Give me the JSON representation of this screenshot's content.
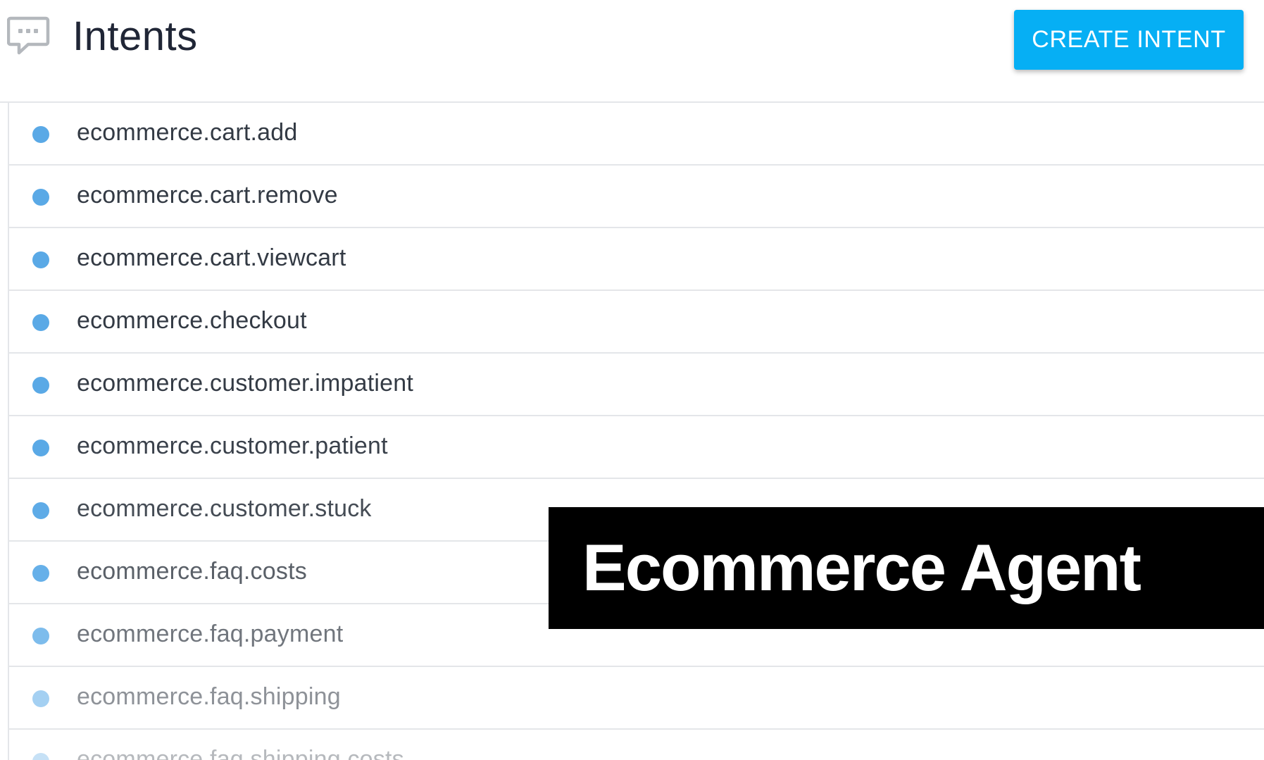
{
  "header": {
    "icon": "chat-bubble-icon",
    "title": "Intents",
    "create_button_label": "CREATE INTENT",
    "accent_color": "#06aff4"
  },
  "intents": [
    {
      "name": "ecommerce.cart.add",
      "dot_color": "#5aa9e6",
      "text_color": "#333a44"
    },
    {
      "name": "ecommerce.cart.remove",
      "dot_color": "#5aa9e6",
      "text_color": "#333a44"
    },
    {
      "name": "ecommerce.cart.viewcart",
      "dot_color": "#5aa9e6",
      "text_color": "#333a44"
    },
    {
      "name": "ecommerce.checkout",
      "dot_color": "#5aa9e6",
      "text_color": "#333a44"
    },
    {
      "name": "ecommerce.customer.impatient",
      "dot_color": "#5aa9e6",
      "text_color": "#343b45"
    },
    {
      "name": "ecommerce.customer.patient",
      "dot_color": "#5aa9e6",
      "text_color": "#3a414b"
    },
    {
      "name": "ecommerce.customer.stuck",
      "dot_color": "#5eabe7",
      "text_color": "#454c55"
    },
    {
      "name": "ecommerce.faq.costs",
      "dot_color": "#66b0e9",
      "text_color": "#5a6068"
    },
    {
      "name": "ecommerce.faq.payment",
      "dot_color": "#7dbcec",
      "text_color": "#71767d"
    },
    {
      "name": "ecommerce.faq.shipping",
      "dot_color": "#a4d0f2",
      "text_color": "#8e9298"
    },
    {
      "name": "ecommerce.faq.shipping.costs",
      "dot_color": "#c6e1f6",
      "text_color": "#b6b9bd"
    }
  ],
  "caption": {
    "text": "Ecommerce Agent"
  }
}
